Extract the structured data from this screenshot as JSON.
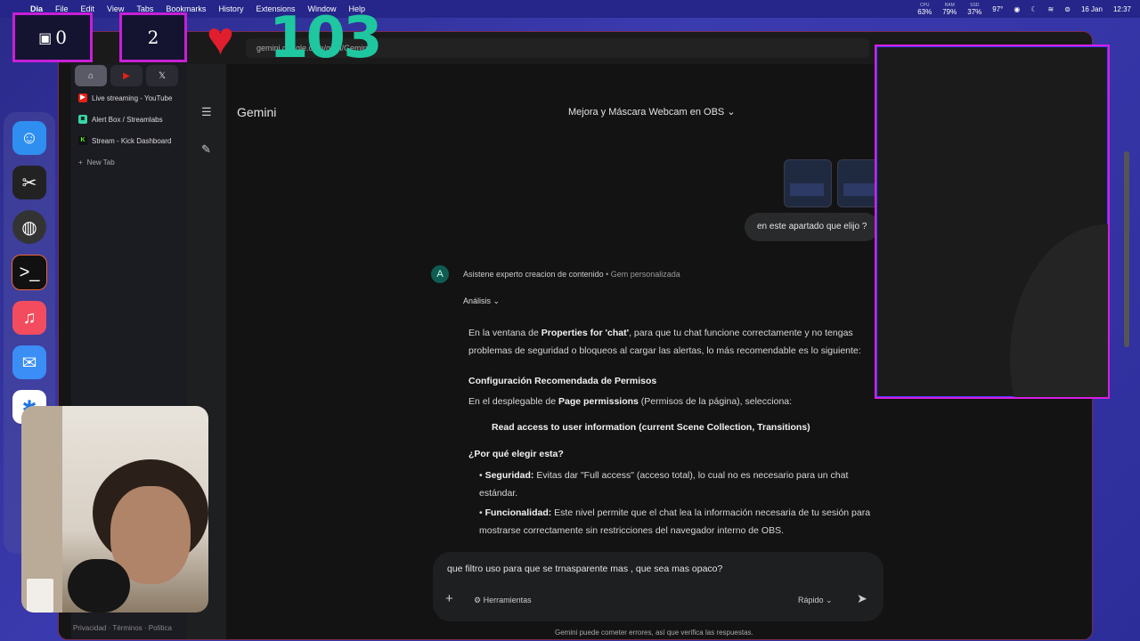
{
  "menubar": {
    "items": [
      "Dia",
      "File",
      "Edit",
      "View",
      "Tabs",
      "Bookmarks",
      "History",
      "Extensions",
      "Window",
      "Help"
    ],
    "status": {
      "cpu": "63%",
      "cpu_label": "CPU",
      "ram": "79%",
      "ram_label": "RAM",
      "disk": "37%",
      "disk_label": "SSD",
      "temp": "97°",
      "date": "16 Jan",
      "time": "12:37"
    }
  },
  "browser": {
    "url": "gemini.google.com/gem/Gemini",
    "pinned": [
      "⌂",
      "▶",
      "𝕏"
    ],
    "tabs": [
      {
        "label": "Live streaming - YouTube",
        "color": "#e62117",
        "glyph": "▶"
      },
      {
        "label": "Alert Box / Streamlabs",
        "color": "#37d6a3",
        "glyph": "◙"
      },
      {
        "label": "Stream - Kick Dashboard",
        "color": "#53fc18",
        "glyph": "K"
      }
    ],
    "new_tab": "New Tab",
    "footer": "Privacidad · Términos · Política"
  },
  "gemini": {
    "title": "Gemini",
    "chat_title": "Mejora y Máscara Webcam en OBS",
    "user_message": "en este apartado que elijo ?",
    "assistant_initial": "A",
    "assistant_name": "Asistene experto creacion de contenido",
    "assistant_suffix": " • Gem personalizada",
    "analysis_label": "Análisis",
    "response": {
      "p1_a": "En la ventana de ",
      "p1_b": "Properties for 'chat'",
      "p1_c": ", para que tu chat funcione correctamente y no tengas problemas de seguridad o bloqueos al cargar las alertas, lo más recomendable es lo siguiente:",
      "h1": "Configuración Recomendada de Permisos",
      "p2_a": "En el desplegable de ",
      "p2_b": "Page permissions",
      "p2_c": " (Permisos de la página), selecciona:",
      "choice": "Read access to user information (current Scene Collection, Transitions)",
      "h2": "¿Por qué elegir esta?",
      "b1_title": "Seguridad:",
      "b1_text": " Evitas dar \"Full access\" (acceso total), lo cual no es necesario para un chat estándar.",
      "b2_title": "Funcionalidad:",
      "b2_text": " Este nivel permite que el chat lea la información necesaria de tu sesión para mostrarse correctamente sin restricciones del navegador interno de OBS."
    },
    "input_text": "que filtro uso para que se trnasparente mas , que sea mas opaco?",
    "tools_label": "Herramientas",
    "model_label": "Rápido",
    "disclaimer": "Gemini puede cometer errores, así que verifica las respuestas."
  },
  "overlay": {
    "counter1": "0",
    "counter1_icon": "▣",
    "counter2": "2",
    "likes": "103",
    "accent": "#c81fd6",
    "likes_color": "#1fc7a0"
  }
}
